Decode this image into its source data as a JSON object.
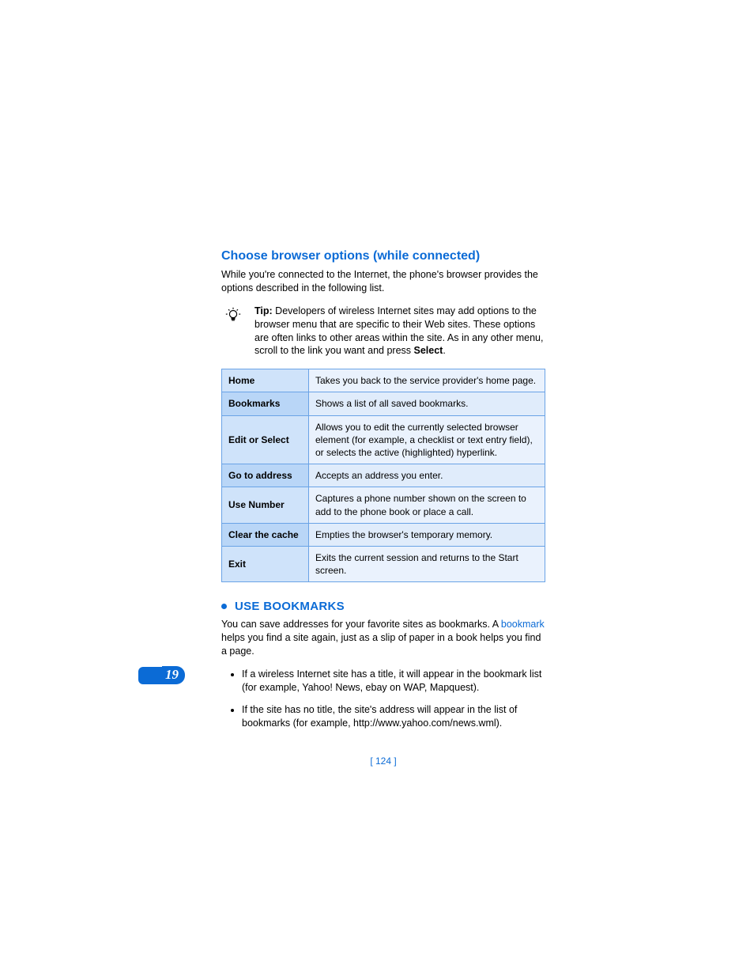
{
  "section": {
    "heading": "Choose browser options (while connected)",
    "intro": "While you're connected to the Internet, the phone's browser provides the options described in the following list."
  },
  "tip": {
    "label": "Tip:",
    "text_a": " Developers of wireless Internet sites may add options to the browser menu that are specific to their Web sites. These options are often links to other areas within the site. As in any other menu, scroll to the link you want and press ",
    "select_word": "Select",
    "text_b": "."
  },
  "options": [
    {
      "name": "Home",
      "desc": "Takes you back to the service provider's home page."
    },
    {
      "name": "Bookmarks",
      "desc": "Shows a list of all saved bookmarks."
    },
    {
      "name": "Edit or Select",
      "desc": "Allows you to edit the currently selected browser element (for example, a checklist or text entry field), or selects the active (highlighted) hyperlink."
    },
    {
      "name": "Go to address",
      "desc": "Accepts an address you enter."
    },
    {
      "name": "Use Number",
      "desc": "Captures a phone number shown on the screen to add to the phone book or place a call."
    },
    {
      "name": "Clear the cache",
      "desc": "Empties the browser's temporary memory."
    },
    {
      "name": "Exit",
      "desc": "Exits the current session and returns to the Start screen."
    }
  ],
  "bookmarks": {
    "heading": "USE BOOKMARKS",
    "p_a": "You can save addresses for your favorite sites as bookmarks. A ",
    "term": "bookmark",
    "p_b": " helps you find a site again, just as a slip of paper in a book helps you find a page.",
    "bullets": [
      "If a wireless Internet site has a title, it will appear in the bookmark list (for example, Yahoo! News, ebay on WAP, Mapquest).",
      "If the site has no title, the site's address will appear in the list of bookmarks (for example, http://www.yahoo.com/news.wml)."
    ]
  },
  "chapter_number": "19",
  "page_number": "[ 124 ]"
}
